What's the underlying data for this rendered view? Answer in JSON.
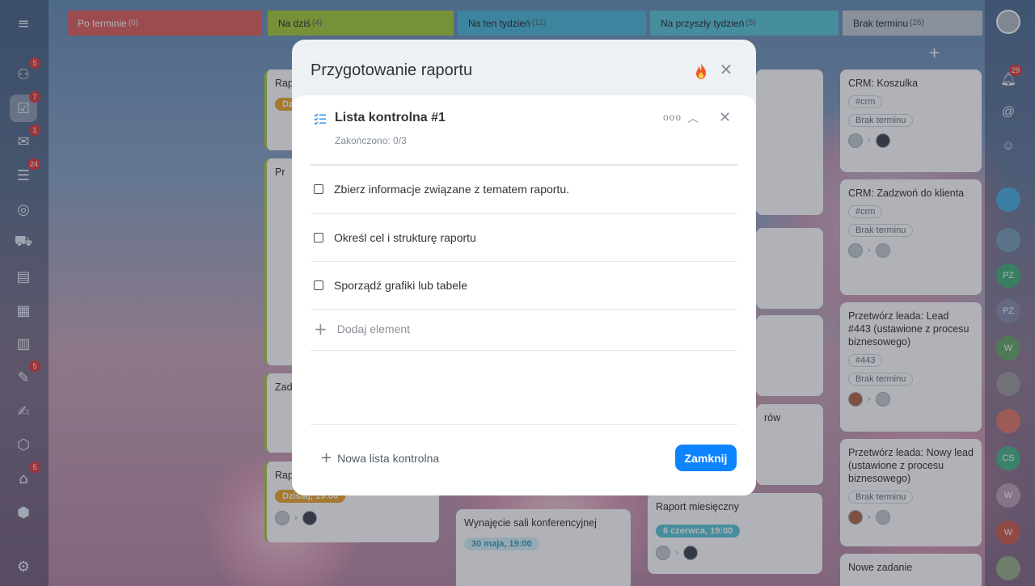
{
  "columns": [
    {
      "label": "Po terminie",
      "count": "(0)",
      "color": "#e0625e"
    },
    {
      "label": "Na dziś",
      "count": "(4)",
      "color": "#a8cc3c"
    },
    {
      "label": "Na ten tydzień",
      "count": "(12)",
      "color": "#4fb9d9"
    },
    {
      "label": "Na przyszły tydzień",
      "count": "(5)",
      "color": "#5cc7d8"
    },
    {
      "label": "Brak terminu",
      "count": "(26)",
      "color": "#c4cbd2"
    }
  ],
  "sidebar_badges": [
    "5",
    "7",
    "1",
    "24",
    "5",
    "5"
  ],
  "right_badge": "29",
  "cards_right": [
    {
      "title": "CRM: Koszulka",
      "tag": "#crm",
      "deadline": "Brak terminu"
    },
    {
      "title": "CRM: Zadzwoń do klienta",
      "tag": "#crm",
      "deadline": "Brak terminu"
    },
    {
      "title": "Przetwórz leada: Lead #443 (ustawione z procesu biznesowego)",
      "tag": "#443",
      "deadline": "Brak terminu"
    },
    {
      "title": "Przetwórz leada: Nowy lead (ustawione z procesu biznesowego)",
      "deadline": "Brak terminu"
    },
    {
      "title": "Nowe zadanie"
    }
  ],
  "cards_other": {
    "rap1": "Rap",
    "pr": "Pr",
    "zad": "Zadz",
    "rap2": "Rap",
    "date_today": "Dzisiaj, 19:00",
    "conf_title": "Wynajęcie sali konferencyjnej",
    "conf_date": "30 maja, 19:00",
    "monthly_title": "Raport miesięczny",
    "monthly_date": "6 czerwca, 19:00",
    "orow": "rów",
    "dz": "Dz"
  },
  "modal": {
    "title": "Przygotowanie raportu",
    "checklist_title": "Lista kontrolna #1",
    "completed": "Zakończono: 0/3",
    "items": [
      "Zbierz informacje związane z tematem raportu.",
      "Określ cel i strukturę raportu",
      "Sporządź grafiki lub tabele"
    ],
    "add_element": "Dodaj element",
    "new_checklist": "Nowa lista kontrolna",
    "close_button": "Zamknij",
    "more_icon": "ooo"
  }
}
